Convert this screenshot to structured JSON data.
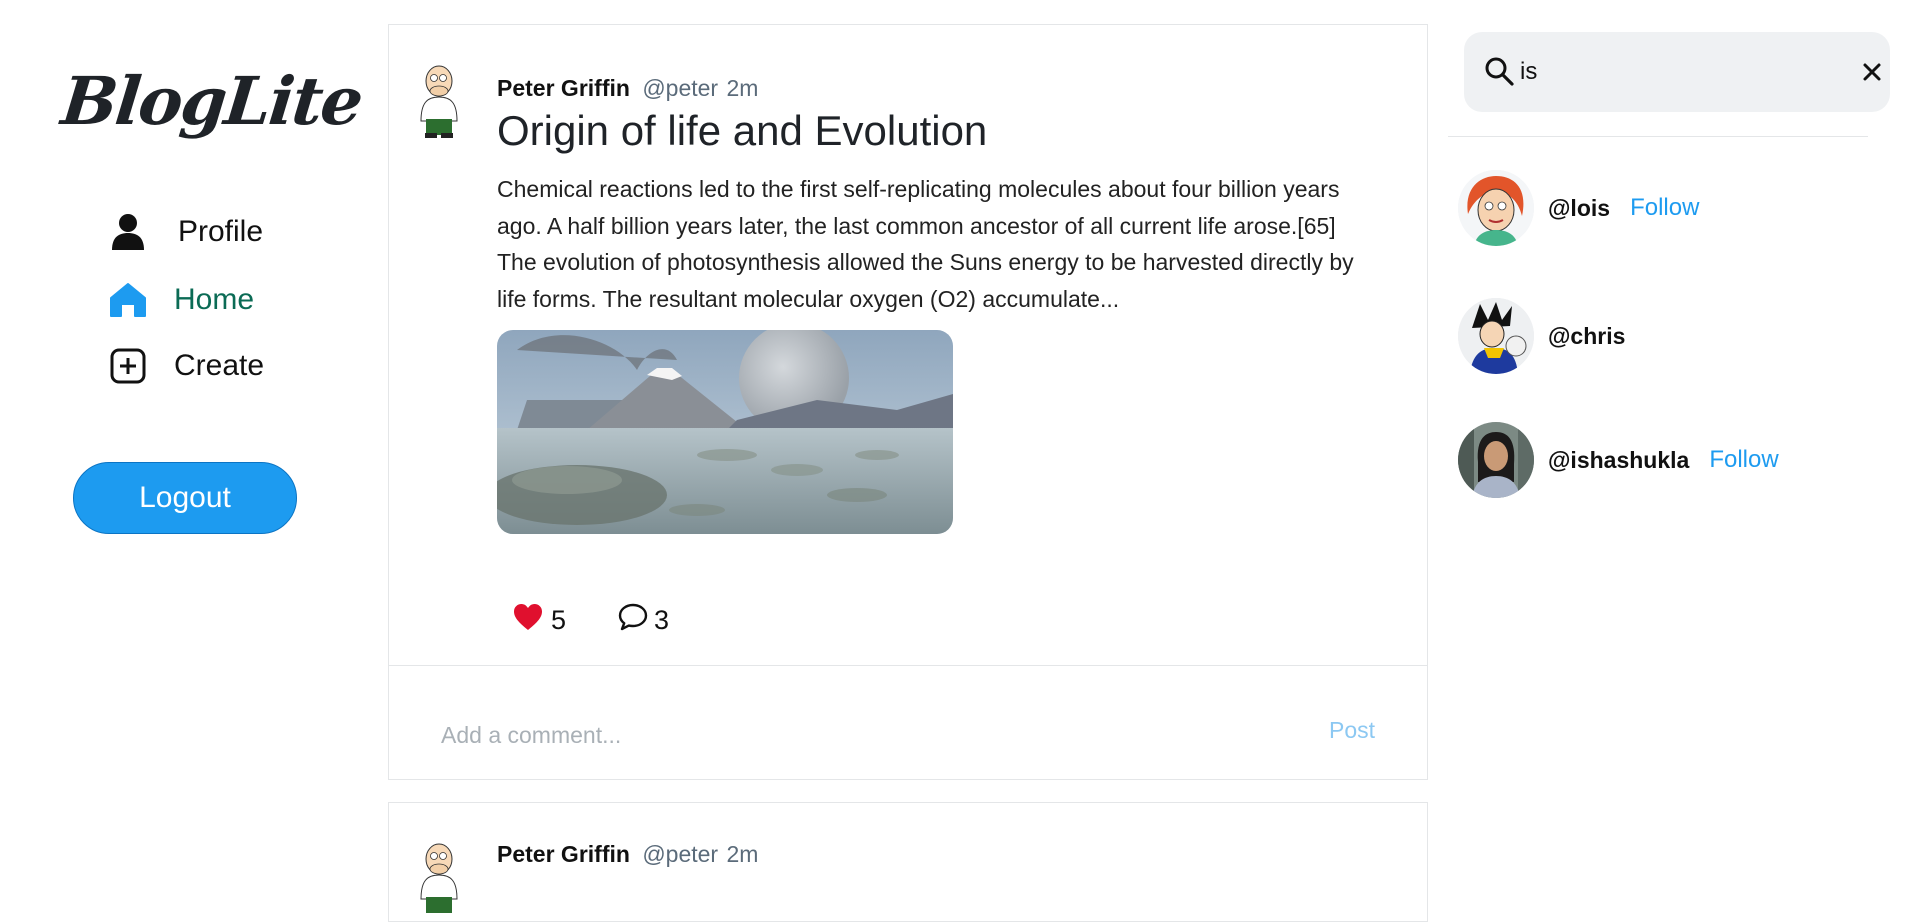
{
  "brand": {
    "logo": "BlogLite"
  },
  "nav": {
    "items": [
      {
        "label": "Profile",
        "icon": "person-icon"
      },
      {
        "label": "Home",
        "icon": "home-icon",
        "active": true
      },
      {
        "label": "Create",
        "icon": "plus-square-icon"
      }
    ],
    "logout_label": "Logout"
  },
  "posts": [
    {
      "author": "Peter Griffin",
      "handle": "@peter",
      "time": "2m",
      "title": "Origin of life and Evolution",
      "body": "Chemical reactions led to the first self-replicating molecules about four billion years ago. A half billion years later, the last common ancestor of all current life arose.[65] The evolution of photosynthesis allowed the Suns energy to be harvested directly by life forms. The resultant molecular oxygen (O2) accumulate...",
      "likes": "5",
      "comments": "3",
      "comment_placeholder": "Add a comment...",
      "post_label": "Post"
    },
    {
      "author": "Peter Griffin",
      "handle": "@peter",
      "time": "2m"
    }
  ],
  "search": {
    "query": "is"
  },
  "results": [
    {
      "handle": "@lois",
      "follow_label": "Follow"
    },
    {
      "handle": "@chris"
    },
    {
      "handle": "@ishashukla",
      "follow_label": "Follow"
    }
  ],
  "colors": {
    "accent": "#1d9bf0",
    "active_nav": "#0b6b55",
    "like": "#e0102e"
  }
}
